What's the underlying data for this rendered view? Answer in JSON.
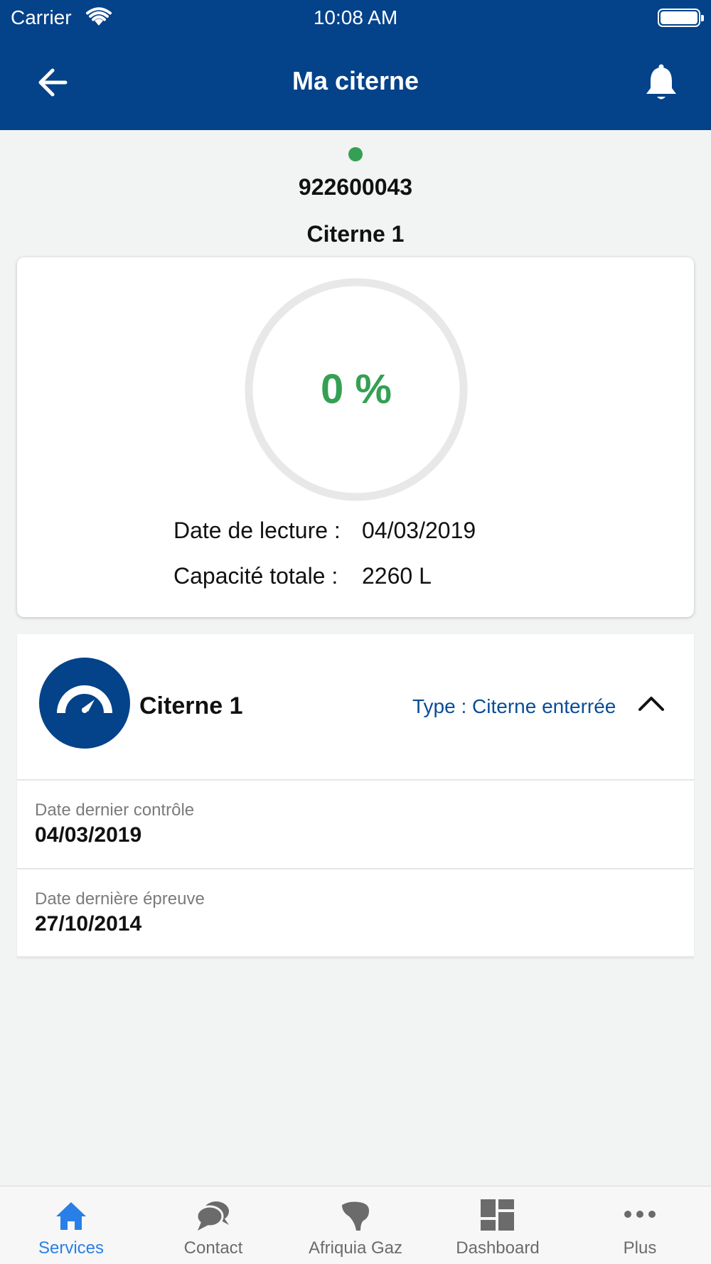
{
  "status_bar": {
    "carrier": "Carrier",
    "time": "10:08 AM"
  },
  "header": {
    "title": "Ma citerne",
    "back_icon": "arrow-left-icon",
    "bell_icon": "bell-icon"
  },
  "tank": {
    "number": "922600043",
    "name": "Citerne 1",
    "status_color": "#35a053"
  },
  "gauge": {
    "fill_percent": 0,
    "percent_text": "0 %",
    "read_date_label": "Date de lecture :",
    "read_date_value": "04/03/2019",
    "capacity_label": "Capacité totale :",
    "capacity_value": "2260 L"
  },
  "details": {
    "title": "Citerne 1",
    "type": "Type : Citerne enterrée",
    "fields": [
      {
        "label": "Date dernier contrôle",
        "value": "04/03/2019"
      },
      {
        "label": "Date dernière épreuve",
        "value": "27/10/2014"
      }
    ]
  },
  "tabbar": {
    "items": [
      {
        "label": "Services",
        "icon": "home-icon",
        "active": true
      },
      {
        "label": "Contact",
        "icon": "chat-bubbles-icon",
        "active": false
      },
      {
        "label": "Afriquia Gaz",
        "icon": "afriquia-logo-icon",
        "active": false
      },
      {
        "label": "Dashboard",
        "icon": "dashboard-grid-icon",
        "active": false
      },
      {
        "label": "Plus",
        "icon": "more-dots-icon",
        "active": false
      }
    ]
  },
  "colors": {
    "brand_blue": "#04428a",
    "accent_green": "#35a053",
    "active_tab": "#2a7fe6",
    "type_text": "#0a4d96"
  }
}
